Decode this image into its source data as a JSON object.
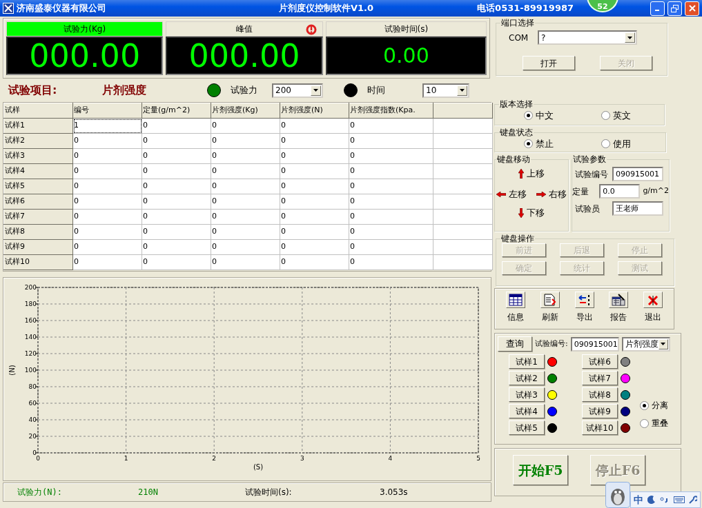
{
  "window": {
    "company": "济南盛泰仪器有限公司",
    "title": "片剂度仪控制软件V1.0",
    "phone": "电话0531-89919987",
    "badge": "52"
  },
  "displays": [
    {
      "label": "试验力(Kg)",
      "value": "000.00",
      "highlighted": true
    },
    {
      "label": "峰值",
      "value": "000.00",
      "highlighted": false
    },
    {
      "label": "试验时间(s)",
      "value": "0.00",
      "highlighted": false
    }
  ],
  "port": {
    "title": "端口选择",
    "label": "COM",
    "value": "?",
    "buttons": [
      {
        "label": "打开",
        "disabled": false
      },
      {
        "label": "关闭",
        "disabled": true
      }
    ]
  },
  "project": {
    "label": "试验项目:",
    "value": "片剂强度",
    "indicators": [
      {
        "label": "试验力",
        "color": "#008000",
        "value": "200"
      },
      {
        "label": "时间",
        "color": "#000000",
        "value": "10"
      }
    ]
  },
  "table": {
    "columns": [
      "试样",
      "编号",
      "定量(g/m^2)",
      "片剂强度(Kg)",
      "片剂强度(N)",
      "片剂强度指数(Kpa."
    ],
    "rows": [
      {
        "cells": [
          "试样1",
          "1",
          "0",
          "0",
          "0",
          "0"
        ],
        "focused": true
      },
      {
        "cells": [
          "试样2",
          "0",
          "0",
          "0",
          "0",
          "0"
        ],
        "focused": false
      },
      {
        "cells": [
          "试样3",
          "0",
          "0",
          "0",
          "0",
          "0"
        ],
        "focused": false
      },
      {
        "cells": [
          "试样4",
          "0",
          "0",
          "0",
          "0",
          "0"
        ],
        "focused": false
      },
      {
        "cells": [
          "试样5",
          "0",
          "0",
          "0",
          "0",
          "0"
        ],
        "focused": false
      },
      {
        "cells": [
          "试样6",
          "0",
          "0",
          "0",
          "0",
          "0"
        ],
        "focused": false
      },
      {
        "cells": [
          "试样7",
          "0",
          "0",
          "0",
          "0",
          "0"
        ],
        "focused": false
      },
      {
        "cells": [
          "试样8",
          "0",
          "0",
          "0",
          "0",
          "0"
        ],
        "focused": false
      },
      {
        "cells": [
          "试样9",
          "0",
          "0",
          "0",
          "0",
          "0"
        ],
        "focused": false
      },
      {
        "cells": [
          "试样10",
          "0",
          "0",
          "0",
          "0",
          "0"
        ],
        "focused": false
      }
    ]
  },
  "chart": {
    "chart_data": {
      "type": "line",
      "grid": true,
      "xlabel": "(S)",
      "ylabel": "(N)",
      "xlim": [
        0,
        5
      ],
      "ylim": [
        0,
        200
      ],
      "xticks": [
        0,
        1,
        2,
        3,
        4,
        5
      ],
      "yticks": [
        0,
        20,
        40,
        60,
        80,
        100,
        120,
        140,
        160,
        180,
        200
      ]
    }
  },
  "status": [
    {
      "label": "试验力(N):",
      "value": "210N",
      "highlighted": true
    },
    {
      "label": "试验时间(s):",
      "value": "3.053s",
      "highlighted": false
    }
  ],
  "version": {
    "title": "版本选择",
    "options": [
      {
        "label": "中文",
        "selected": true
      },
      {
        "label": "英文",
        "selected": false
      }
    ]
  },
  "keyboard_state": {
    "title": "键盘状态",
    "options": [
      {
        "label": "禁止",
        "selected": true
      },
      {
        "label": "使用",
        "selected": false
      }
    ]
  },
  "keyboard_move": {
    "title": "键盘移动",
    "up": "上移",
    "left": "左移",
    "right": "右移",
    "down": "下移"
  },
  "test_params": {
    "title": "试验参数",
    "fields": [
      {
        "label": "试验编号",
        "value": "090915001"
      },
      {
        "label": "定量",
        "value": "0.0",
        "unit": "g/m^2"
      },
      {
        "label": "试验员",
        "value": "王老师"
      }
    ]
  },
  "keyboard_ops": {
    "title": "键盘操作",
    "buttons": [
      {
        "label": "前进",
        "disabled": true
      },
      {
        "label": "后退",
        "disabled": true
      },
      {
        "label": "停止",
        "disabled": true
      },
      {
        "label": "确定",
        "disabled": true
      },
      {
        "label": "统计",
        "disabled": true
      },
      {
        "label": "测试",
        "disabled": true
      }
    ]
  },
  "toolbar": [
    {
      "label": "信息"
    },
    {
      "label": "刷新"
    },
    {
      "label": "导出"
    },
    {
      "label": "报告"
    },
    {
      "label": "退出"
    }
  ],
  "query": {
    "button": "查询",
    "label": "试验编号:",
    "value": "090915001",
    "select": "片剂强度",
    "samples": [
      {
        "label": "试样1",
        "color": "#ff0000"
      },
      {
        "label": "试样2",
        "color": "#008000"
      },
      {
        "label": "试样3",
        "color": "#ffff00"
      },
      {
        "label": "试样4",
        "color": "#0000ff"
      },
      {
        "label": "试样5",
        "color": "#000000"
      },
      {
        "label": "试样6",
        "color": "#808080"
      },
      {
        "label": "试样7",
        "color": "#ff00ff"
      },
      {
        "label": "试样8",
        "color": "#008080"
      },
      {
        "label": "试样9",
        "color": "#000080"
      },
      {
        "label": "试样10",
        "color": "#800000"
      }
    ],
    "modes": [
      {
        "label": "分离",
        "selected": true
      },
      {
        "label": "重叠",
        "selected": false
      }
    ]
  },
  "start": [
    {
      "label": "开始F5",
      "disabled": false
    },
    {
      "label": "停止F6",
      "disabled": true
    }
  ],
  "ime": {
    "label": "中"
  }
}
